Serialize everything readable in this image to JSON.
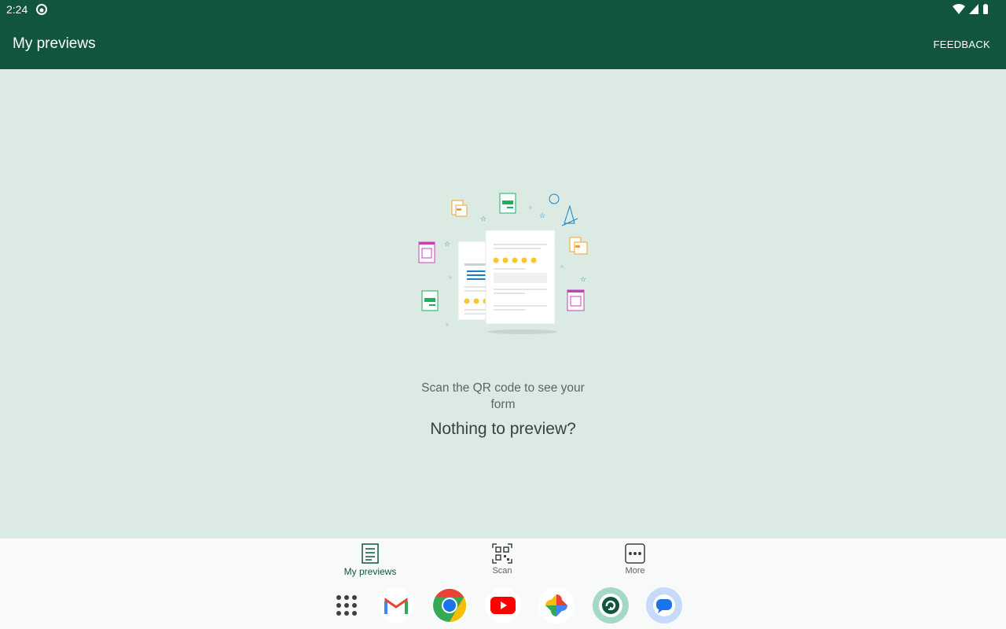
{
  "status_bar": {
    "time": "2:24"
  },
  "app_bar": {
    "title": "My previews",
    "feedback_label": "FEEDBACK"
  },
  "empty_state": {
    "title": "Nothing to preview?",
    "subtitle": "Scan the QR code to see your form"
  },
  "bottom_nav": {
    "items": [
      {
        "label": "My previews",
        "icon": "list-doc-icon",
        "active": true
      },
      {
        "label": "Scan",
        "icon": "qr-code-icon",
        "active": false
      },
      {
        "label": "More",
        "icon": "more-dots-icon",
        "active": false
      }
    ]
  },
  "dock": {
    "apps": [
      "app-drawer-icon",
      "gmail-icon",
      "chrome-icon",
      "youtube-icon",
      "photos-icon",
      "app-sync-icon",
      "messages-icon"
    ]
  },
  "colors": {
    "primary": "#11563c",
    "background": "#dbebe3",
    "nav_background": "#f8f9f9"
  }
}
